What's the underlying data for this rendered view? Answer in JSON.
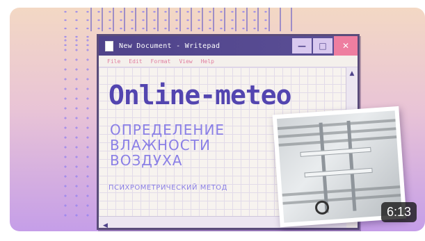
{
  "window": {
    "title": "New Document - Writepad",
    "menu": [
      "File",
      "Edit",
      "Format",
      "View",
      "Help"
    ],
    "min_glyph": "—",
    "max_glyph": "□",
    "close_glyph": "✕"
  },
  "content": {
    "headline": "Online-meteo",
    "line1": "ОПРЕДЕЛЕНИЕ",
    "line2": "ВЛАЖНОСТИ",
    "line3": "ВОЗДУХА",
    "subtitle": "ПСИХРОМЕТРИЧЕСКИЙ МЕТОД"
  },
  "video": {
    "duration": "6:13"
  },
  "icons": {
    "document": "document-icon",
    "scroll_up": "arrow-up-icon",
    "scroll_left": "arrow-left-icon"
  },
  "colors": {
    "accent": "#5345b0",
    "highlight": "#8a7fe6",
    "close": "#ee7ea0"
  }
}
